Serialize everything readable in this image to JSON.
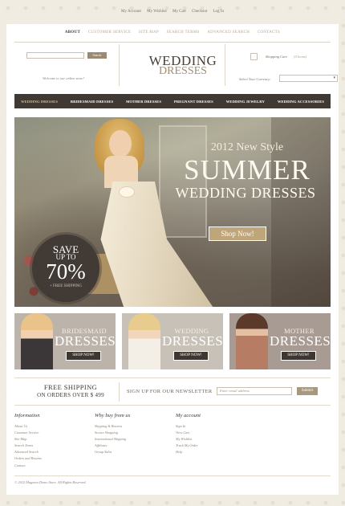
{
  "colors": {
    "dark_bar": "#3f3833",
    "accent_gold": "#bfa57a",
    "page_bg": "#f1ece2"
  },
  "account_links": [
    "My Account",
    "My Wishlist",
    "My Cart",
    "Checkout",
    "Log In"
  ],
  "main_nav": [
    "ABOUT",
    "CUSTOMER SERVICE",
    "SITE MAP",
    "SEARCH TERMS",
    "ADVANCED SEARCH",
    "CONTACTS"
  ],
  "search": {
    "button": "Search",
    "value": "",
    "welcome": "Welcome to our online store!"
  },
  "logo": {
    "line1": "WEDDING",
    "line2": "DRESSES"
  },
  "cart": {
    "icon": "shopping-bag-icon",
    "label": "Shopping Cart:",
    "items": "(0 Items)"
  },
  "currency": {
    "label": "Select Your Currency:",
    "value": ""
  },
  "categories": [
    "WEDDING DRESSES",
    "BRIDESMAID DRESSES",
    "MOTHER DRESSES",
    "PREGNANT DRESSES",
    "WEDDING JEWELRY",
    "WEDDING ACCESSORIES"
  ],
  "hero": {
    "line1": "2012 New Style",
    "line2": "SUMMER",
    "line3": "WEDDING DRESSES",
    "button": "Shop Now!",
    "badge": {
      "save": "SAVE",
      "upto": "UP TO",
      "percent": "70%",
      "shipping": "+ FREE SHIPPING"
    }
  },
  "promos": [
    {
      "small": "BRIDESMAID",
      "big": "DRESSES",
      "button": "SHOP NOW!"
    },
    {
      "small": "WEDDING",
      "big": "DRESSES",
      "button": "SHOP NOW!"
    },
    {
      "small": "MOTHER",
      "big": "DRESSES",
      "button": "SHOP NOW!"
    }
  ],
  "shipping": {
    "line1": "FREE SHIPPING",
    "line2": "ON ORDERS OVER $ 499"
  },
  "newsletter": {
    "label": "SIGN UP FOR OUR NEWSLETTER",
    "placeholder": "Enter email address",
    "button": "Submit"
  },
  "footer": {
    "columns": [
      {
        "title": "Information",
        "links": [
          "About Us",
          "Customer Service",
          "Site Map",
          "Search Terms",
          "Advanced Search",
          "Orders and Returns",
          "Contact"
        ]
      },
      {
        "title": "Why buy from us",
        "links": [
          "Shipping & Returns",
          "Secure Shopping",
          "International Shipping",
          "Affiliates",
          "Group Sales"
        ]
      },
      {
        "title": "My account",
        "links": [
          "Sign In",
          "View Cart",
          "My Wishlist",
          "Track My Order",
          "Help"
        ]
      }
    ],
    "copyright": "© 2012 Magento Demo Store. All Rights Reserved."
  }
}
